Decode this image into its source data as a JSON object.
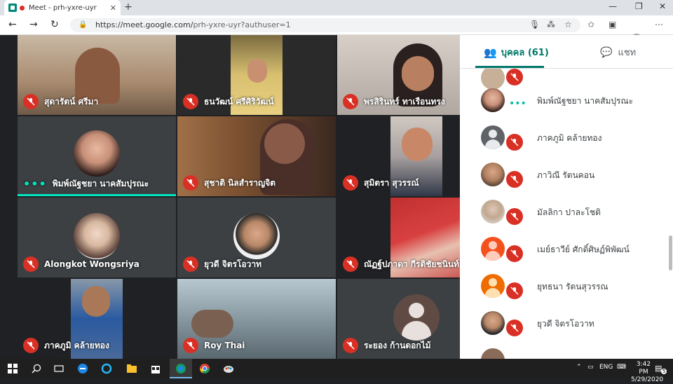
{
  "browser": {
    "tab_title": "Meet - prh-yxre-uyr",
    "new_tab": "+",
    "url_host": "https://meet.google.com/",
    "url_path": "prh-yxre-uyr?authuser=1",
    "window_controls": [
      "—",
      "❐",
      "✕"
    ]
  },
  "tiles": [
    {
      "name": "สุดารัตน์ ศรีมา",
      "muted": true,
      "bg": "#a08c7a"
    },
    {
      "name": "ธนวัฒน์ ศรีศิริวัฒน์",
      "muted": true,
      "bg": "#4a4a3a"
    },
    {
      "name": "พรสิรินทร์ ทาเรือนทรง",
      "muted": true,
      "bg": "#c8c0b8"
    },
    {
      "name": "พิมพ์ณัฐชยา นาคสัมปุรณะ",
      "muted": false,
      "speaking": true,
      "bg": "#3c4043"
    },
    {
      "name": "สุชาติ นิลสำราญจิต",
      "muted": true,
      "bg": "#6b4a30"
    },
    {
      "name": "สุมิตรา สุวรรณ์",
      "muted": true,
      "bg": "#303030"
    },
    {
      "name": "Alongkot Wongsriya",
      "muted": true,
      "bg": "#3c4043"
    },
    {
      "name": "ยุวดี จิตรโอวาท",
      "muted": true,
      "bg": "#3c4043"
    },
    {
      "name": "ณัฏฐ์ปภาดา กีรติชัยชนินท์",
      "muted": true,
      "bg": "#b83030"
    },
    {
      "name": "ภาคภูมิ คล้ายทอง",
      "muted": true,
      "bg": "#3a5a8a"
    },
    {
      "name": "Roy Thai",
      "muted": true,
      "bg": "#8a98a0"
    },
    {
      "name": "ระยอง ก้านดอกไม้",
      "muted": true,
      "bg": "#3c4043"
    }
  ],
  "panel": {
    "people_tab": "บุคคล (61)",
    "chat_tab": "แชท",
    "participants": [
      {
        "name": "พิมพ์ณัฐชยา นาคสัมปุรณะ",
        "status": "speaking"
      },
      {
        "name": "ภาคภูมิ คล้ายทอง",
        "status": "muted"
      },
      {
        "name": "ภาวิณี รัตนคอน",
        "status": "muted"
      },
      {
        "name": "มัลลิกา ปาละโชติ",
        "status": "muted"
      },
      {
        "name": "เมย์ธาวีย์ ศักดิ์ศิษฏ์พิพัฒน์",
        "status": "muted"
      },
      {
        "name": "ยุทธนา รัตนสุวรรณ",
        "status": "muted"
      },
      {
        "name": "ยุวดี จิตรโอวาท",
        "status": "muted"
      }
    ]
  },
  "taskbar": {
    "time": "3:42 PM",
    "date": "5/29/2020",
    "lang": "ENG",
    "notif_count": "5"
  },
  "colors": {
    "mute_red": "#d93025",
    "accent_teal": "#00796b",
    "speaking_teal": "#00e5c0"
  }
}
